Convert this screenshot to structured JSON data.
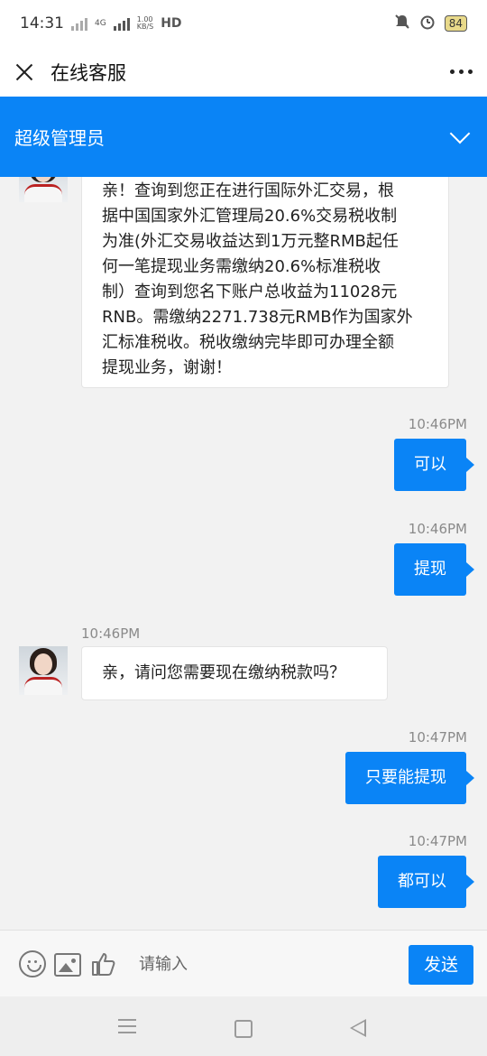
{
  "status_bar": {
    "time": "14:31",
    "net_speed_value": "1.00",
    "net_speed_unit": "KB/S",
    "network_type": "4G",
    "hd": "HD",
    "battery": "84"
  },
  "header": {
    "title": "在线客服"
  },
  "agent_bar": {
    "name": "超级管理员"
  },
  "messages": [
    {
      "side": "left",
      "text_lines": [
        "亲！查询到您正在进行国际外汇交易，根",
        "据中国国家外汇管理局20.6%交易税收制",
        "为准(外汇交易收益达到1万元整RMB起任",
        "何一笔提现业务需缴纳20.6%标准税收",
        "制）查询到您名下账户总收益为11028元",
        "RNB。需缴纳2271.738元RMB作为国家外",
        "汇标准税收。税收缴纳完毕即可办理全额",
        "提现业务，谢谢！"
      ]
    },
    {
      "side": "right",
      "time": "10:46PM",
      "text": "可以"
    },
    {
      "side": "right",
      "time": "10:46PM",
      "text": "提现"
    },
    {
      "side": "left",
      "time": "10:46PM",
      "text": "亲，请问您需要现在缴纳税款吗？"
    },
    {
      "side": "right",
      "time": "10:47PM",
      "text": "只要能提现"
    },
    {
      "side": "right",
      "time": "10:47PM",
      "text": "都可以"
    }
  ],
  "input_bar": {
    "placeholder": "请输入",
    "send_label": "发送",
    "icons": [
      "emoji-icon",
      "image-icon",
      "thumbs-up-icon"
    ]
  },
  "colors": {
    "accent": "#0a84f6",
    "background": "#f2f2f2"
  }
}
